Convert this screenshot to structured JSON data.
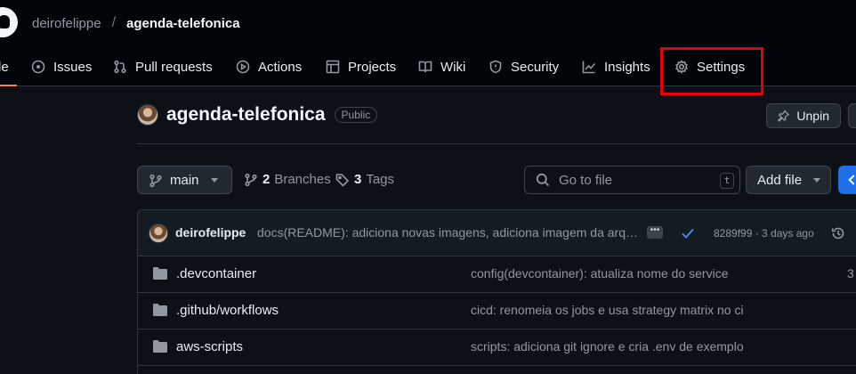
{
  "breadcrumb": {
    "owner": "deirofelippe",
    "separator": "/",
    "repo": "agenda-telefonica"
  },
  "tabs": [
    {
      "label": "le",
      "icon": "code-icon"
    },
    {
      "label": "Issues",
      "icon": "issue-icon"
    },
    {
      "label": "Pull requests",
      "icon": "pull-request-icon"
    },
    {
      "label": "Actions",
      "icon": "play-icon"
    },
    {
      "label": "Projects",
      "icon": "table-icon"
    },
    {
      "label": "Wiki",
      "icon": "book-icon"
    },
    {
      "label": "Security",
      "icon": "shield-icon"
    },
    {
      "label": "Insights",
      "icon": "graph-icon"
    },
    {
      "label": "Settings",
      "icon": "gear-icon"
    }
  ],
  "repo": {
    "name": "agenda-telefonica",
    "visibility": "Public",
    "unpin_label": "Unpin"
  },
  "toolbar": {
    "branch": "main",
    "branches_count": "2",
    "branches_label": "Branches",
    "tags_count": "3",
    "tags_label": "Tags",
    "go_to_file_placeholder": "Go to file",
    "go_to_file_shortcut": "t",
    "add_file_label": "Add file"
  },
  "latest_commit": {
    "author": "deirofelippe",
    "message": "docs(README): adiciona novas imagens, adiciona imagem da arquitetura",
    "ellipsis": "•••",
    "info": "8289f99 · 3 days ago"
  },
  "files": [
    {
      "name": ".devcontainer",
      "commit": "config(devcontainer): atualiza nome do service",
      "date": "3"
    },
    {
      "name": ".github/workflows",
      "commit": "cicd: renomeia os jobs e usa strategy matrix no ci",
      "date": ""
    },
    {
      "name": "aws-scripts",
      "commit": "scripts: adiciona git ignore e cria .env de exemplo",
      "date": ""
    }
  ],
  "colors": {
    "accent_blue": "#1f6feb",
    "tab_underline": "#f78166",
    "highlight": "#e5000c",
    "background": "#0d1117",
    "header": "#010409"
  }
}
